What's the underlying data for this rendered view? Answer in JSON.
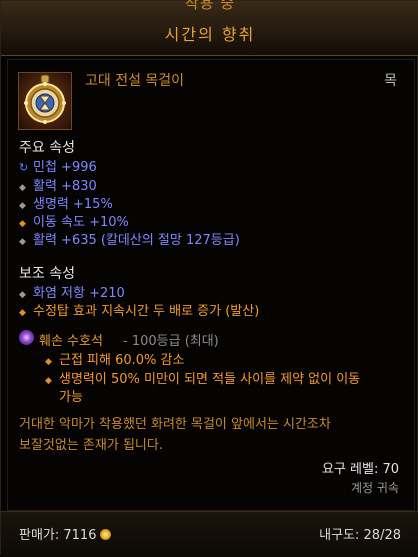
{
  "header": {
    "top_label": "착용 중",
    "item_title": "시간의 향취"
  },
  "item": {
    "name": "고대 전설 목걸이",
    "slot": "목"
  },
  "primary": {
    "title": "주요 속성",
    "stats": [
      "민첩 +996",
      "활력 +830",
      "생명력 +15%",
      "이동 속도 +10%",
      "활력 +635 (칼데산의 절망 127등급)"
    ]
  },
  "secondary": {
    "title": "보조 속성",
    "stats": [
      "화염 저항 +210",
      "수정탑 효과 지속시간 두 배로 증가 (발산)"
    ]
  },
  "gem": {
    "name": "훼손 수호석",
    "rank": "- 100등급 (최대)",
    "effects": [
      "근접 피해 60.0% 감소",
      "생명력이 50% 미만이 되면 적들 사이를 제약 없이 이동",
      "가능"
    ]
  },
  "flavor": {
    "line1": "거대한 악마가 착용했던 화려한 목걸이 앞에서는 시간조차",
    "line2": "보잘것없는 존재가 됩니다."
  },
  "requirements": {
    "level": "요구 레벨: 70",
    "account_bound": "계정 귀속"
  },
  "footer": {
    "price": "판매가: 7116",
    "durability": "내구도: 28/28"
  }
}
